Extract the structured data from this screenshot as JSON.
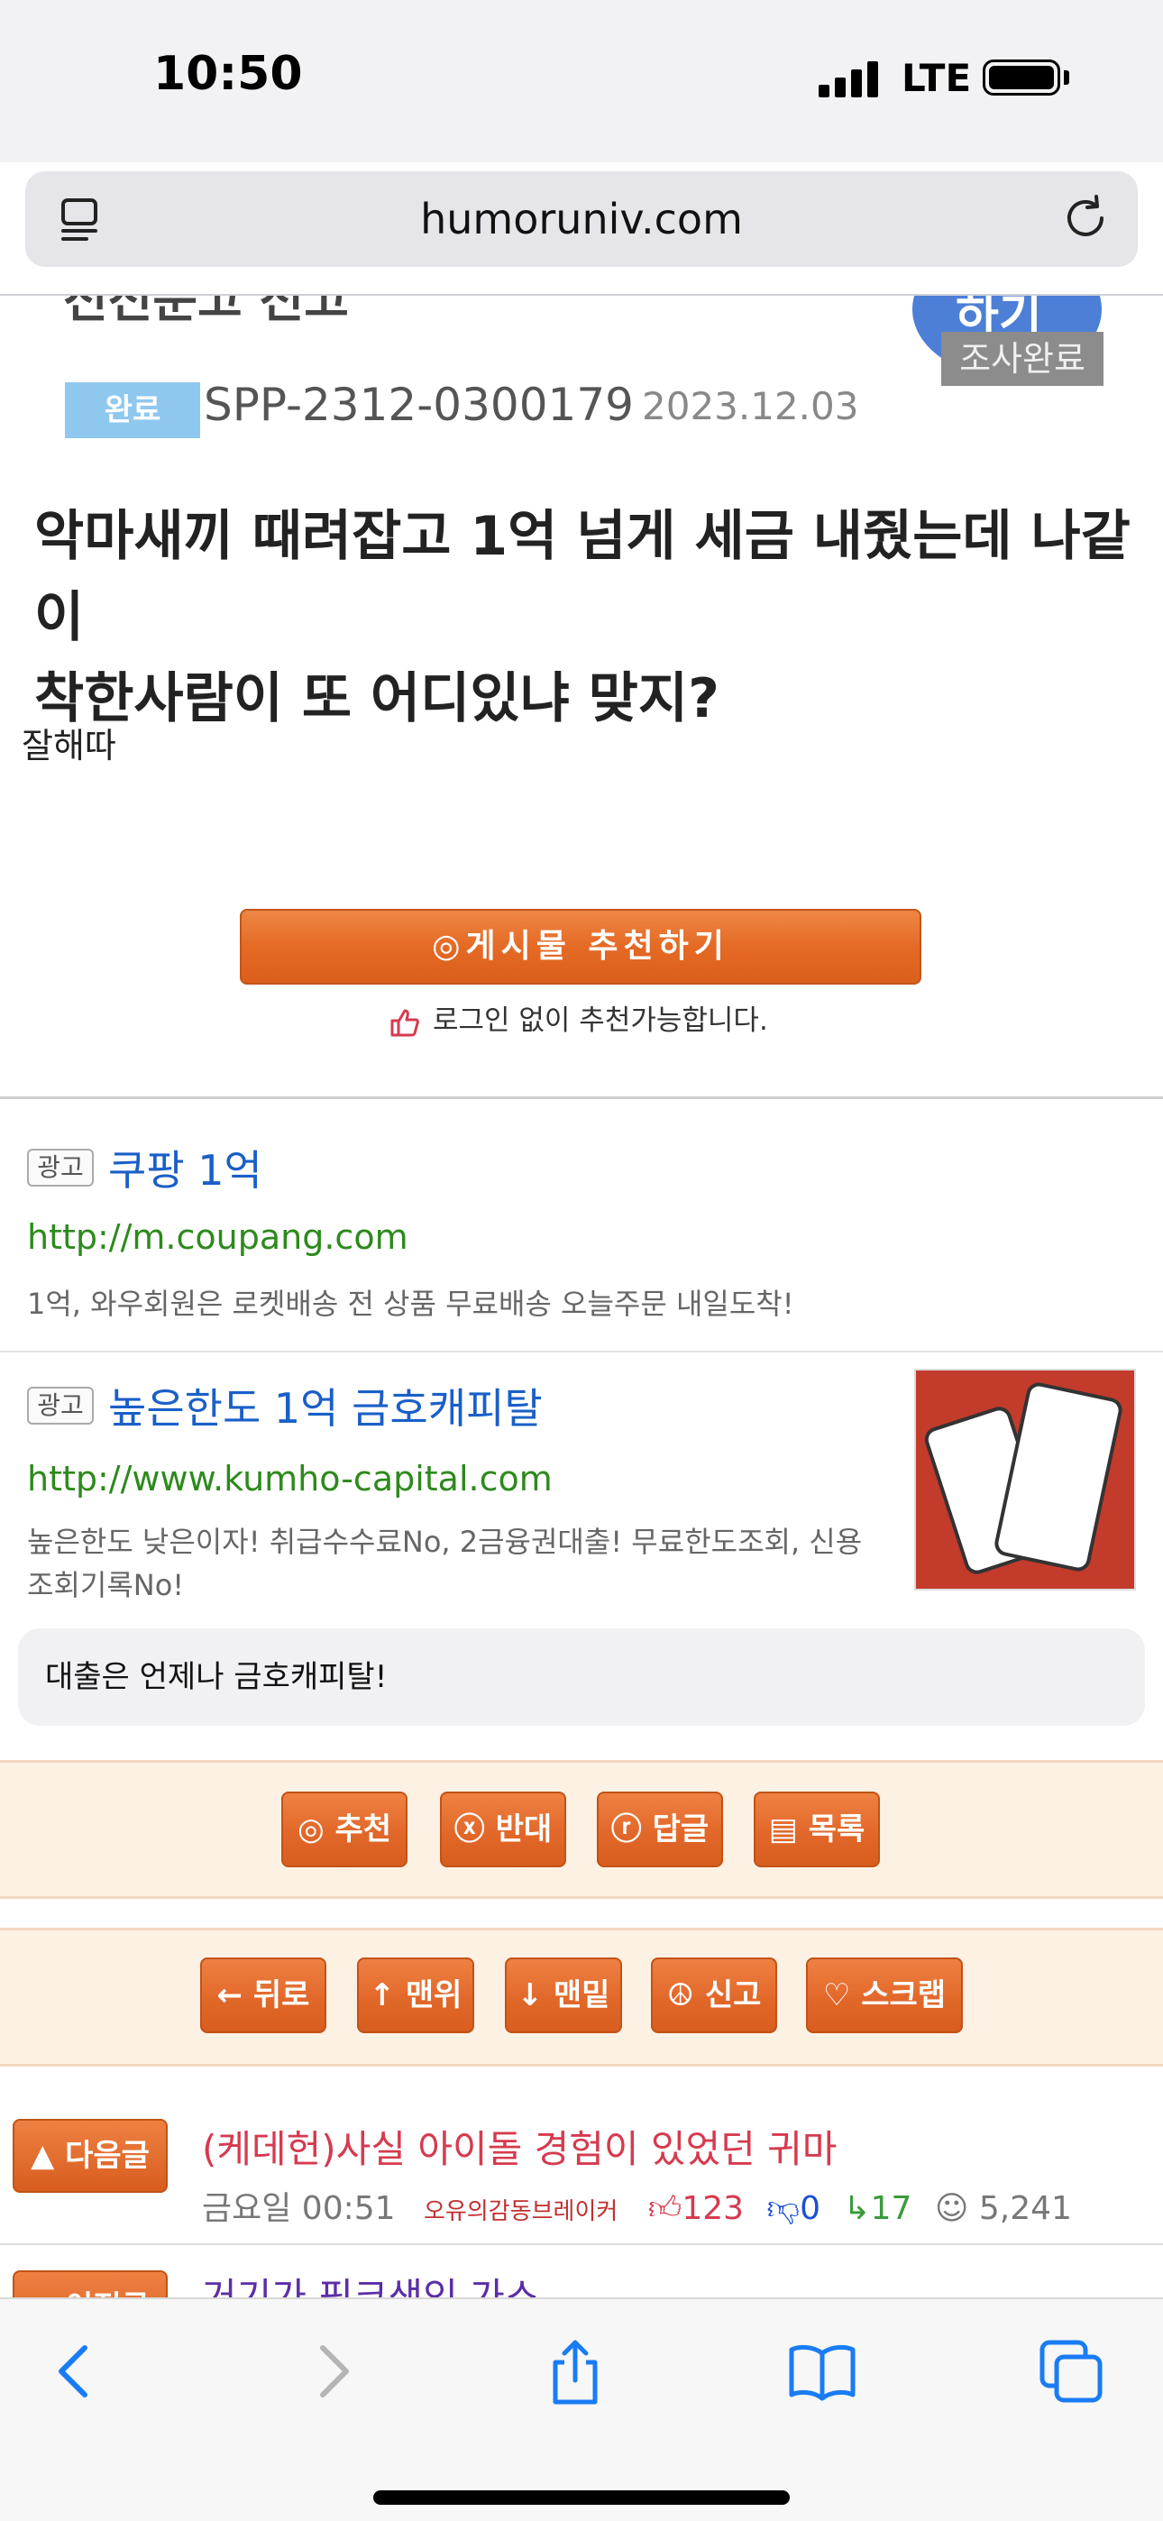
{
  "status_bar": {
    "time": "10:50",
    "network": "LTE"
  },
  "browser": {
    "url": "humoruniv.com"
  },
  "post": {
    "hero_cut_text": "전전문고 전고",
    "badge_main": "하기",
    "badge_sub": "조사완료",
    "status_label": "완료",
    "case_id": "SPP-2312-0300179",
    "date": "2023.12.03",
    "headline_line1": "악마새끼 때려잡고 1억 넘게 세금 내줬는데 나같이",
    "headline_line2": "착한사람이 또 어디있냐 맞지?",
    "body": "잘해따",
    "recommend_button": "◎게시물 추천하기",
    "recommend_note": "로그인 없이 추천가능합니다."
  },
  "ads": [
    {
      "badge": "광고",
      "title": "쿠팡 1억",
      "url": "http://m.coupang.com",
      "desc": "1억, 와우회원은 로켓배송 전 상품 무료배송 오늘주문 내일도착!"
    },
    {
      "badge": "광고",
      "title": "높은한도 1억 금호캐피탈",
      "url": "http://www.kumho-capital.com",
      "desc_line1": "높은한도 낮은이자! 취급수수료No, 2금융권대출! 무료한도조회, 신용",
      "desc_line2": "조회기록No!",
      "callout": "대출은 언제나 금호캐피탈!"
    }
  ],
  "actions_row1": [
    {
      "label": "◎ 추천"
    },
    {
      "label": "ⓧ 반대"
    },
    {
      "label": "ⓡ 답글"
    },
    {
      "label": "▤ 목록"
    }
  ],
  "actions_row2": [
    {
      "label": "← 뒤로"
    },
    {
      "label": "↑ 맨위"
    },
    {
      "label": "↓ 맨밑"
    },
    {
      "label": "☮ 신고"
    },
    {
      "label": "♡ 스크랩"
    }
  ],
  "next_post": {
    "button": "▲ 다음글",
    "title": "(케데헌)사실 아이돌 경험이 있었던 귀마",
    "day_time": "금요일 00:51",
    "author": "오유의감동브레이커",
    "up": "123",
    "down": "0",
    "replies": "17",
    "views": "5,241"
  },
  "prev_post": {
    "button": "▼ 이전글",
    "title": "거기가 핑크색인 가스"
  },
  "colors": {
    "accent_orange": "#e2682a",
    "link_blue": "#1a5fc7",
    "url_green": "#2d8a1c",
    "next_red": "#d63a4f"
  },
  "icons": [
    "back-icon",
    "forward-icon",
    "share-icon",
    "bookmarks-icon",
    "tabs-icon",
    "reload-icon",
    "reader-icon",
    "thumb-up-icon"
  ]
}
